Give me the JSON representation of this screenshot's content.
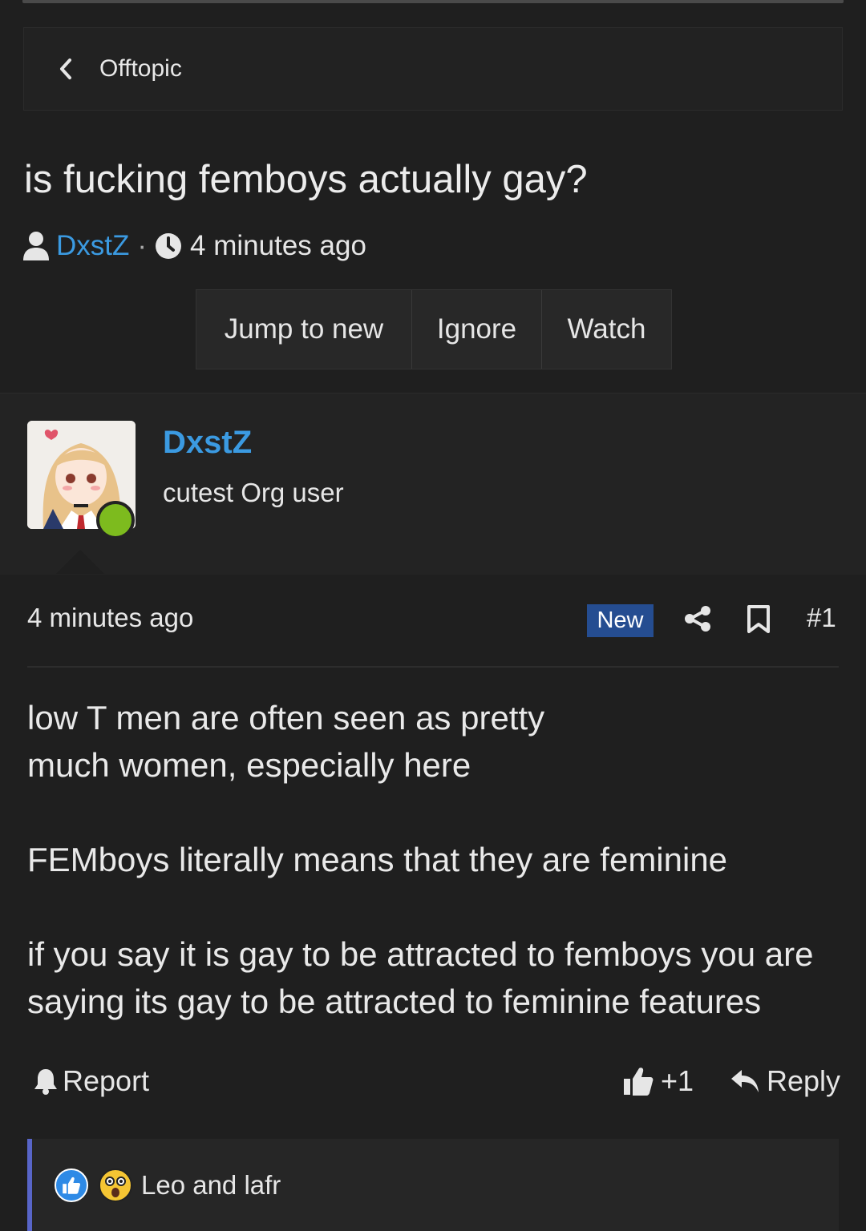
{
  "breadcrumb": {
    "label": "Offtopic"
  },
  "thread": {
    "title": "is fucking femboys actually gay?",
    "author": "DxstZ",
    "time": "4 minutes ago",
    "buttons": [
      "Jump to new",
      "Ignore",
      "Watch"
    ]
  },
  "post": {
    "username": "DxstZ",
    "user_title": "cutest Org user",
    "online": true,
    "time": "4 minutes ago",
    "badge": "New",
    "number": "#1",
    "paragraphs": [
      "low T men are often seen as pretty much women, especially here",
      "FEMboys literally means that they are feminine",
      "if you say it is gay to be attracted to femboys you are saying its gay to be attracted to feminine features"
    ],
    "actions": {
      "report": "Report",
      "like": "+1",
      "reply": "Reply"
    },
    "reactions_text": "Leo and lafr"
  },
  "colors": {
    "link": "#3b9ae1",
    "badge": "#254d91",
    "online": "#7dbb1e",
    "accent_bar": "#5865c8"
  }
}
